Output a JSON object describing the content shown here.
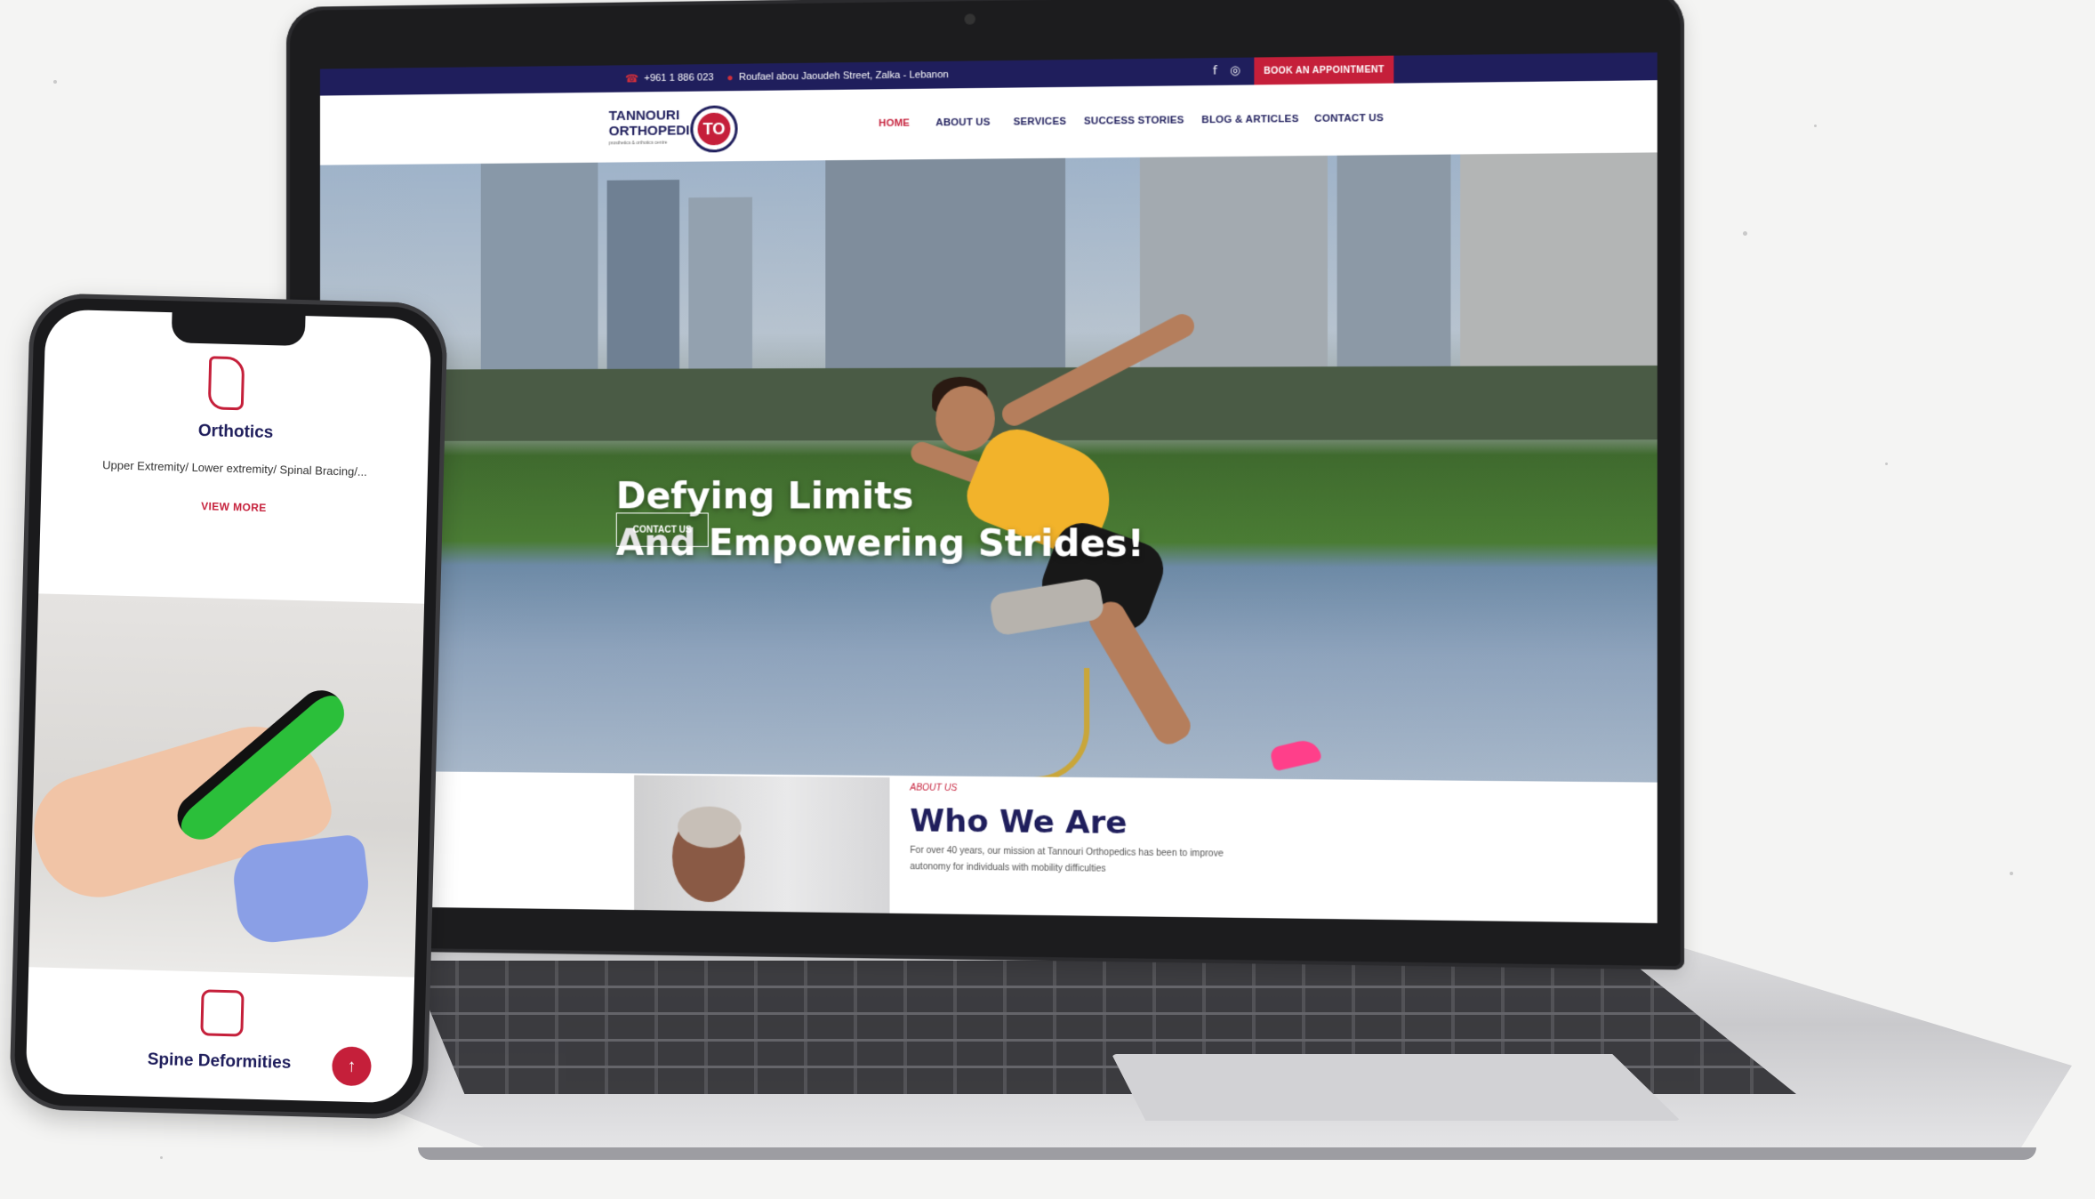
{
  "site": {
    "topbar": {
      "phone": "+961 1 886 023",
      "address": "Roufael abou Jaoudeh Street, Zalka - Lebanon",
      "cta_label": "BOOK AN APPOINTMENT"
    },
    "logo": {
      "line1": "TANNOURI",
      "line2": "ORTHOPEDIC",
      "tagline": "prosthetics & orthotics centre",
      "mark": "TO"
    },
    "nav": [
      {
        "label": "HOME",
        "active": true
      },
      {
        "label": "ABOUT US",
        "active": false
      },
      {
        "label": "SERVICES",
        "active": false
      },
      {
        "label": "SUCCESS STORIES",
        "active": false
      },
      {
        "label": "BLOG & ARTICLES",
        "active": false
      },
      {
        "label": "CONTACT US",
        "active": false
      }
    ],
    "hero": {
      "title_line1": "Defying Limits",
      "title_line2": "And Empowering Strides!",
      "button_label": "CONTACT US"
    },
    "about": {
      "eyebrow": "ABOUT US",
      "title": "Who We Are",
      "text": "For over 40 years, our mission at Tannouri Orthopedics has been to improve autonomy for individuals with mobility difficulties"
    }
  },
  "mobile": {
    "card1": {
      "title": "Orthotics",
      "text": "Upper Extremity/ Lower extremity/ Spinal Bracing/...",
      "link": "VIEW MORE"
    },
    "card2": {
      "title": "Spine Deformities"
    },
    "scroll_top_icon": "arrow-up-icon"
  },
  "colors": {
    "brand_navy": "#1f1e5c",
    "brand_red": "#c51f3a"
  }
}
